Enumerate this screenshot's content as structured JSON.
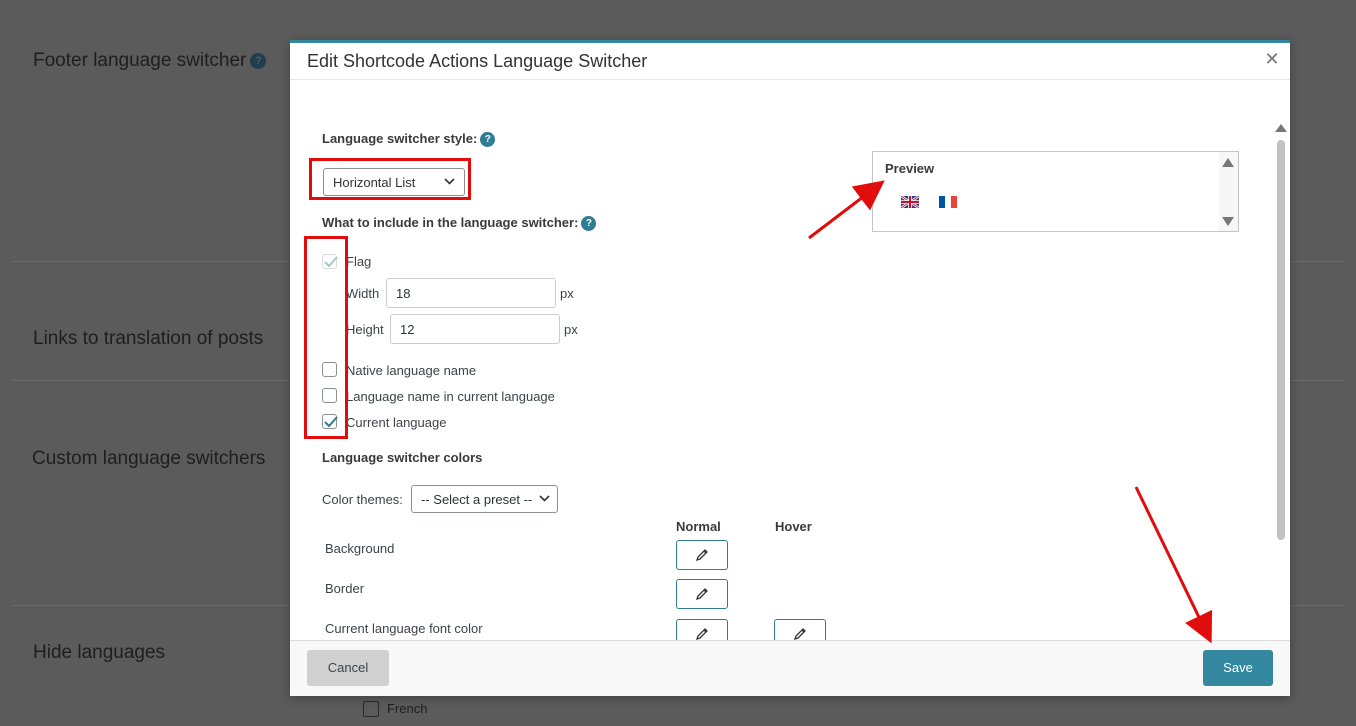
{
  "background": {
    "labels": [
      {
        "text": "Footer language switcher"
      },
      {
        "text": "Links to translation of posts"
      },
      {
        "text": "Custom language switchers"
      },
      {
        "text": "Hide languages"
      }
    ],
    "french_option": "French"
  },
  "modal": {
    "title": "Edit Shortcode Actions Language Switcher",
    "style_label": "Language switcher style:",
    "style_value": "Horizontal List",
    "include_label": "What to include in the language switcher:",
    "flag_label": "Flag",
    "width_label": "Width",
    "width_value": "18",
    "height_label": "Height",
    "height_value": "12",
    "unit": "px",
    "options": [
      {
        "label": "Native language name",
        "checked": false
      },
      {
        "label": "Language name in current language",
        "checked": false
      },
      {
        "label": "Current language",
        "checked": true
      }
    ],
    "colors_label": "Language switcher colors",
    "color_themes_label": "Color themes:",
    "color_themes_value": "-- Select a preset --",
    "col_normal": "Normal",
    "col_hover": "Hover",
    "color_rows": [
      {
        "label": "Background"
      },
      {
        "label": "Border"
      },
      {
        "label": "Current language font color"
      }
    ],
    "preview_label": "Preview",
    "cancel_label": "Cancel",
    "save_label": "Save"
  },
  "colors": {
    "accent": "#33879e",
    "annotation": "#e10d0d"
  }
}
